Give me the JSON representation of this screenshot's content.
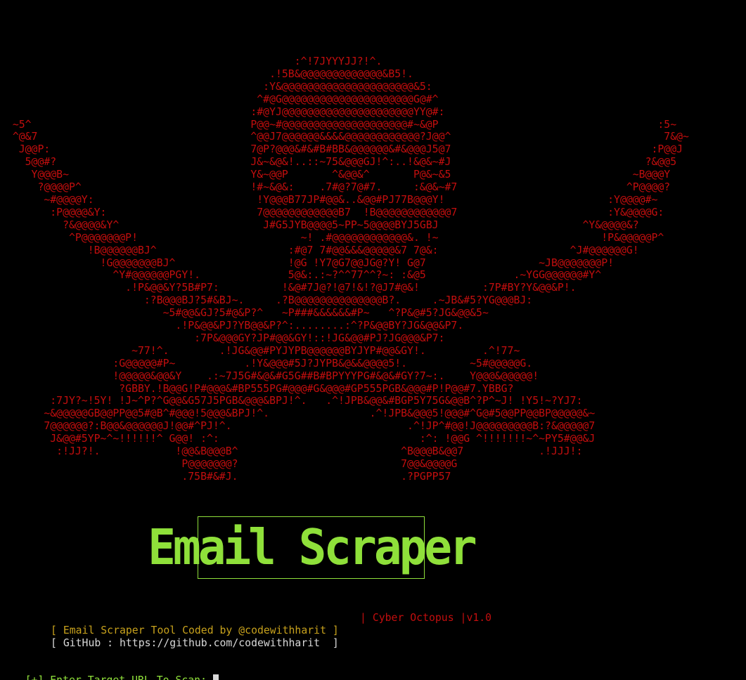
{
  "ascii_art": "                                               :^!7JYYYJJ?!^.\n                                           .!5B&@@@@@@@@@@@@@&B5!.\n                                          :Y&@@@@@@@@@@@@@@@@@@@@@&5:\n                                         ^#@G@@@@@@@@@@@@@@@@@@@@@G@#^\n                                        :#@YJ@@@@@@@@@@@@@@@@@@@@@YY@#:\n  ~5^                                   P@@~#@@@@@@@@@@@@@@@@@@@@#~&@P                                   :5~\n  ^@&7                                  ^@@J7@@@@@@&&&&@@@@@@@@@@@@?J@@^                                  7&@~\n   J@@P:                                7@P?@@@&#&#B#BB&@@@@@@&#&@@@J5@7                                :P@@J\n    5@@#?                               J&~&@&!..::~75&@@@GJ!^:..!&@&~#J                               ?&@@5\n     Y@@@B~                             Y&~@@P       ^&@@&^       P@&~&5                             ~B@@@Y\n      ?@@@@P^                           !#~&@&:    .7#@?7@#7.     :&@&~#7                           ^P@@@@?\n       ~#@@@@Y:                          !Y@@@B77JP#@@&..&@@#PJ77B@@@Y!                          :Y@@@@#~\n        :P@@@@&Y:                        7@@@@@@@@@@@@B7  !B@@@@@@@@@@@@7                        :Y&@@@@G:\n          ?&@@@@&Y^                       J#G5JYB@@@@5~PP~5@@@@BYJ5GBJ                       ^Y&@@@@&?\n           ^P@@@@@@@P!                          ~! .#@@@@@@@@@@@@&. !~                          !P&@@@@@P^\n              !B@@@@@@BJ^                     :#@7 7#@@&&&@@@@@&7 7@&:                     ^J#@@@@@@G!\n                !G@@@@@@@BJ^                  !@G !Y7@G7@@JG@?Y! G@7                  ~JB@@@@@@@P!\n                  ^Y#@@@@@@PGY!.              5@&:.:~?^^77^^?~: :&@5              .~YGG@@@@@@#Y^\n                    .!P&@@&Y?5B#P7:          !&@#7J@?!@7!&!?@J7#@&!          :7P#BY?Y&@@&P!.\n                       :?B@@@BJ?5#&BJ~.     .?B@@@@@@@@@@@@@@B?.     .~JB&#5?YG@@@BJ:\n                          ~5#@@&GJ?5#@&P?^   ~P###&&&&&&#P~   ^?P&@#5?JG&@@&5~\n                            .!P&@@&PJ?YB@@&P?^:........:^?P&@@BY?JG&@@&P7.\n                               :7P&@@@GY?JP#@@&GY!::!JG&@@#PJ?JG@@@&P7:\n                     ~77!^.        .!JG&@@#PYJYPB@@@@@@BYJYP#@@&GY!.         .^!77~\n                  :G@@@@@#P~           .!Y&@@@#5J?JYPB&@&&@@@@5!.          ~5#@@@@@G.\n                  !@@@@@&@@&Y    .:~7J5G#&@&#G5G##B#BPYYYPG#&@&#GY?7~:.    Y@@@&@@@@@!\n                   ?GBBY.!B@@G!P#@@@&#BP555PG#@@@#G&@@@#GP555PGB&@@@#P!P@@#7.YBBG?\n        :7JY?~!5Y! !J~^P?^G@@&G57J5PGB&@@@&BPJ!^.   .^!JPB&@@&#BGP5Y75G&@@B^?P^~J! !Y5!~?YJ7:\n       ~&@@@@@GB@@PP@@5#@B^#@@@!5@@@&BPJ!^.                .^!JPB&@@@5!@@@#^G@#5@@PP@@BP@@@@@&~\n       7@@@@@@?:B@@&@@@@@@J!@@#^PJ!^.                            .^!JP^#@@!J@@@@@@@@@B:?&@@@@@7\n        J&@@#5YP~^~!!!!!!^ G@@! :^:                                :^: !@@G ^!!!!!!!~^~PY5#@@&J\n         :!JJ?!.            !@@&B@@@B^                          ^B@@@B&@@7            .!JJJ!:\n                             P@@@@@@@?                          7@@&@@@@G\n                             .75B#&#J.                          .?PGPP57",
  "banner_title": "Email Scraper",
  "tag_line": "| Cyber Octopus |v1.0",
  "credit_line": "[ Email Scraper Tool Coded by @codewithharit ]",
  "github_line": "[ GitHub : https://github.com/codewithharit  ]",
  "prompt_text": "[+] Enter Target URL To Scan: ",
  "colors": {
    "background": "#000000",
    "art_red": "#c30e0e",
    "banner_green": "#8fe03a",
    "credit_yellow": "#c7a11c",
    "text_white": "#d8d8d8"
  }
}
